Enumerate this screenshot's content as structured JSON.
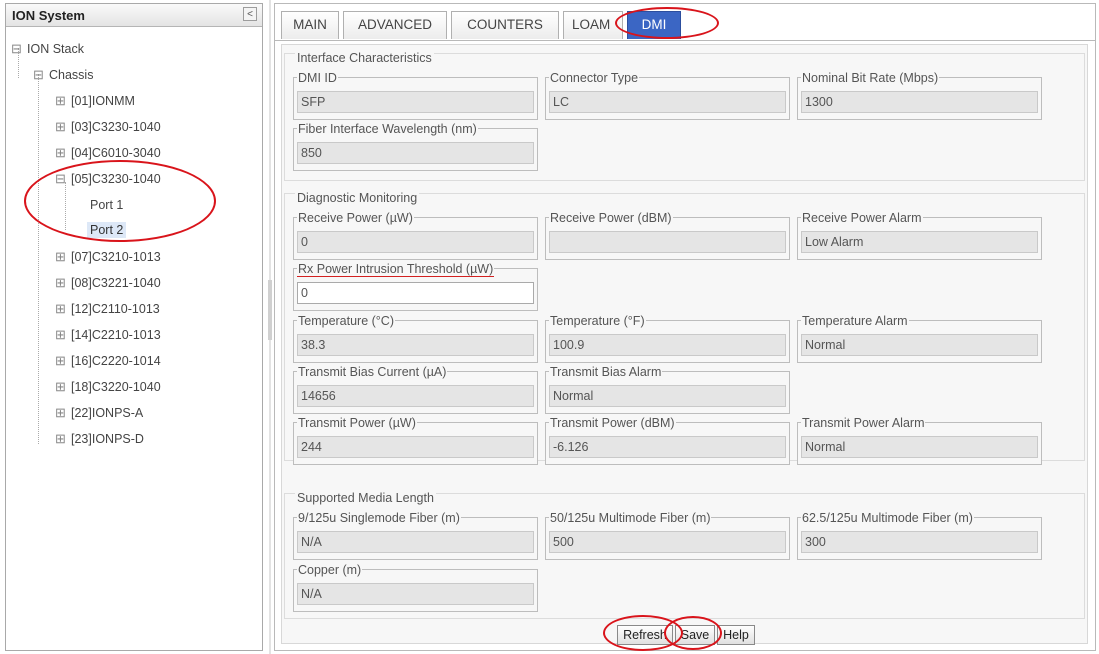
{
  "left_panel": {
    "title": "ION System",
    "collapse_glyph": "<",
    "tree": {
      "root": "ION Stack",
      "chassis": "Chassis",
      "items": [
        "[01]IONMM",
        "[03]C3230-1040",
        "[04]C6010-3040",
        "[05]C3230-1040",
        "[07]C3210-1013",
        "[08]C3221-1040",
        "[12]C2110-1013",
        "[14]C2210-1013",
        "[16]C2220-1014",
        "[18]C3220-1040",
        "[22]IONPS-A",
        "[23]IONPS-D"
      ],
      "ports": [
        "Port 1",
        "Port 2"
      ],
      "selected": "Port 2"
    }
  },
  "tabs": [
    {
      "label": "MAIN",
      "active": false
    },
    {
      "label": "ADVANCED",
      "active": false
    },
    {
      "label": "COUNTERS",
      "active": false
    },
    {
      "label": "LOAM",
      "active": false
    },
    {
      "label": "DMI",
      "active": true
    }
  ],
  "sections": {
    "interface": {
      "title": "Interface Characteristics",
      "fields": [
        {
          "label": "DMI ID",
          "value": "SFP"
        },
        {
          "label": "Connector Type",
          "value": "LC"
        },
        {
          "label": "Nominal Bit Rate (Mbps)",
          "value": "1300"
        },
        {
          "label": "Fiber Interface Wavelength (nm)",
          "value": "850"
        }
      ]
    },
    "diagnostic": {
      "title": "Diagnostic Monitoring",
      "fields": [
        {
          "label": "Receive Power (µW)",
          "value": "0"
        },
        {
          "label": "Receive Power (dBM)",
          "value": ""
        },
        {
          "label": "Receive Power Alarm",
          "value": "Low Alarm"
        },
        {
          "label": "Rx Power Intrusion Threshold (µW)",
          "value": "0"
        },
        {
          "label": "Temperature (°C)",
          "value": "38.3"
        },
        {
          "label": "Temperature (°F)",
          "value": "100.9"
        },
        {
          "label": "Temperature Alarm",
          "value": "Normal"
        },
        {
          "label": "Transmit Bias Current (µA)",
          "value": "14656"
        },
        {
          "label": "Transmit Bias Alarm",
          "value": "Normal"
        },
        {
          "label": "Transmit Power (µW)",
          "value": "244"
        },
        {
          "label": "Transmit Power (dBM)",
          "value": "-6.126"
        },
        {
          "label": "Transmit Power Alarm",
          "value": "Normal"
        }
      ]
    },
    "media": {
      "title": "Supported Media Length",
      "fields": [
        {
          "label": "9/125u Singlemode Fiber (m)",
          "value": "N/A"
        },
        {
          "label": "50/125u Multimode Fiber (m)",
          "value": "500"
        },
        {
          "label": "62.5/125u Multimode Fiber (m)",
          "value": "300"
        },
        {
          "label": "Copper (m)",
          "value": "N/A"
        }
      ]
    }
  },
  "buttons": {
    "refresh": "Refresh",
    "save": "Save",
    "help": "Help"
  },
  "icons": {
    "expand": "plus-in-box",
    "collapse": "minus-in-box"
  },
  "colors": {
    "active_tab": "#3b66c4",
    "annotation": "#d9141b",
    "selected_row": "#dde8f7"
  }
}
